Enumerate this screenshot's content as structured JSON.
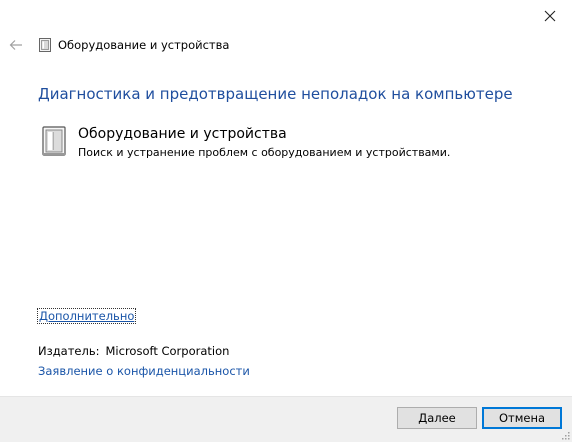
{
  "window": {
    "nav_title": "Оборудование и устройства"
  },
  "heading": "Диагностика и предотвращение неполадок на компьютере",
  "item": {
    "title": "Оборудование и устройства",
    "description": "Поиск и устранение проблем с оборудованием и устройствами."
  },
  "links": {
    "advanced": "Дополнительно",
    "privacy": "Заявление о конфиденциальности"
  },
  "publisher": {
    "label": "Издатель:",
    "value": "Microsoft Corporation"
  },
  "buttons": {
    "next_accel": "Д",
    "next_rest": "алее",
    "cancel": "Отмена"
  },
  "colors": {
    "heading": "#1f4e9e",
    "link": "#1a55a8",
    "footer_bg": "#f0f0f0",
    "focus_border": "#0078d7"
  },
  "icons": {
    "back": "back-arrow-icon",
    "close": "close-icon",
    "troubleshooter": "hardware-device-icon"
  }
}
